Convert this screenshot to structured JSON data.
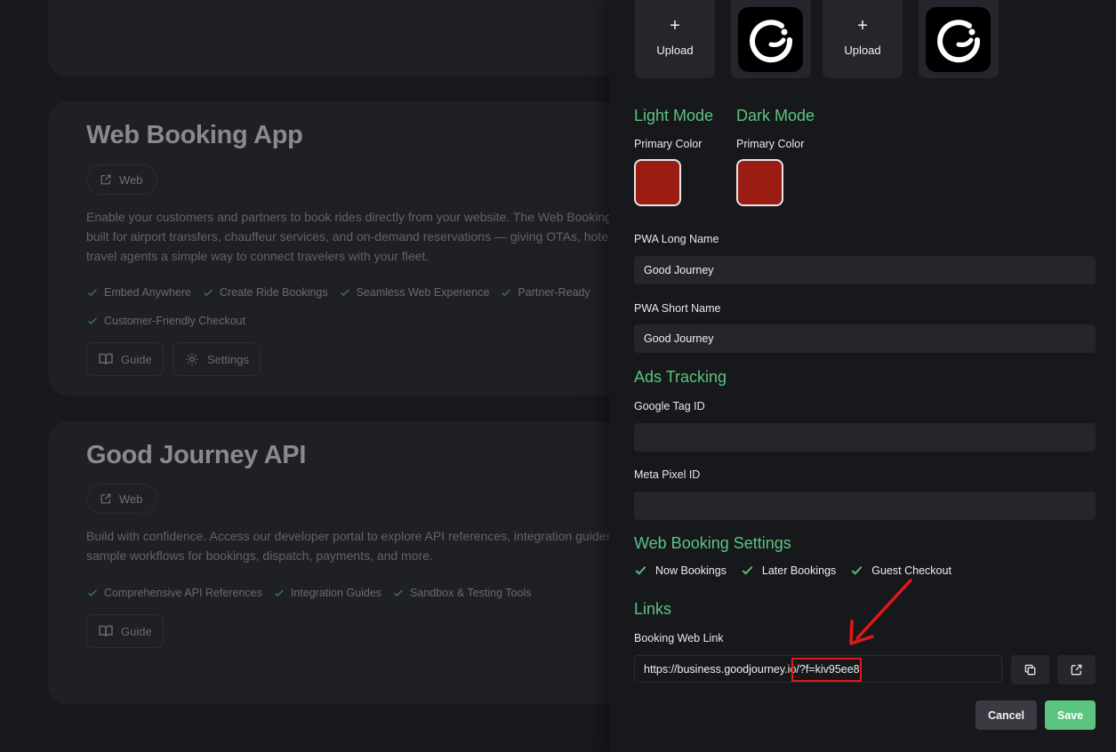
{
  "background": {
    "cards": [
      {
        "title": "Web Booking App",
        "pill": "Web",
        "desc_lines": [
          "Enable your customers and partners to book rides directly from your website. The Web Booking App is",
          "built for airport transfers, chauffeur services, and on-demand reservations — giving OTAs, hotels, and",
          "travel agents a simple way to connect travelers with your fleet."
        ],
        "features_row1": [
          "Embed Anywhere",
          "Create Ride Bookings",
          "Seamless Web Experience",
          "Partner-Ready"
        ],
        "features_row2": [
          "Customer-Friendly Checkout"
        ],
        "guide_label": "Guide",
        "settings_label": "Settings"
      },
      {
        "title": "Good Journey API",
        "pill": "Web",
        "desc_lines": [
          "Build with confidence. Access our developer portal to explore API references, integration guides, and",
          "sample workflows for bookings, dispatch, payments, and more."
        ],
        "features_row1": [
          "Comprehensive API References",
          "Integration Guides",
          "Sandbox & Testing Tools"
        ],
        "guide_label": "Guide"
      }
    ]
  },
  "panel": {
    "upload_label": "Upload",
    "light_mode": {
      "title": "Light Mode",
      "primary_label": "Primary Color",
      "primary_color": "#9b1c13"
    },
    "dark_mode": {
      "title": "Dark Mode",
      "primary_label": "Primary Color",
      "primary_color": "#9b1c13"
    },
    "pwa_long_name": {
      "label": "PWA Long Name",
      "value": "Good Journey"
    },
    "pwa_short_name": {
      "label": "PWA Short Name",
      "value": "Good Journey"
    },
    "ads_tracking": {
      "title": "Ads Tracking",
      "google_tag_label": "Google Tag ID",
      "google_tag_value": "",
      "meta_pixel_label": "Meta Pixel ID",
      "meta_pixel_value": ""
    },
    "web_booking_settings": {
      "title": "Web Booking Settings",
      "options": [
        "Now Bookings",
        "Later Bookings",
        "Guest Checkout"
      ]
    },
    "links": {
      "title": "Links",
      "booking_link_label": "Booking Web Link",
      "booking_link_value": "https://business.goodjourney.io/?f=kiv95ee8"
    },
    "cancel_label": "Cancel",
    "save_label": "Save"
  },
  "colors": {
    "accent_green": "#5cc47e",
    "annotation_red": "#e01818"
  }
}
